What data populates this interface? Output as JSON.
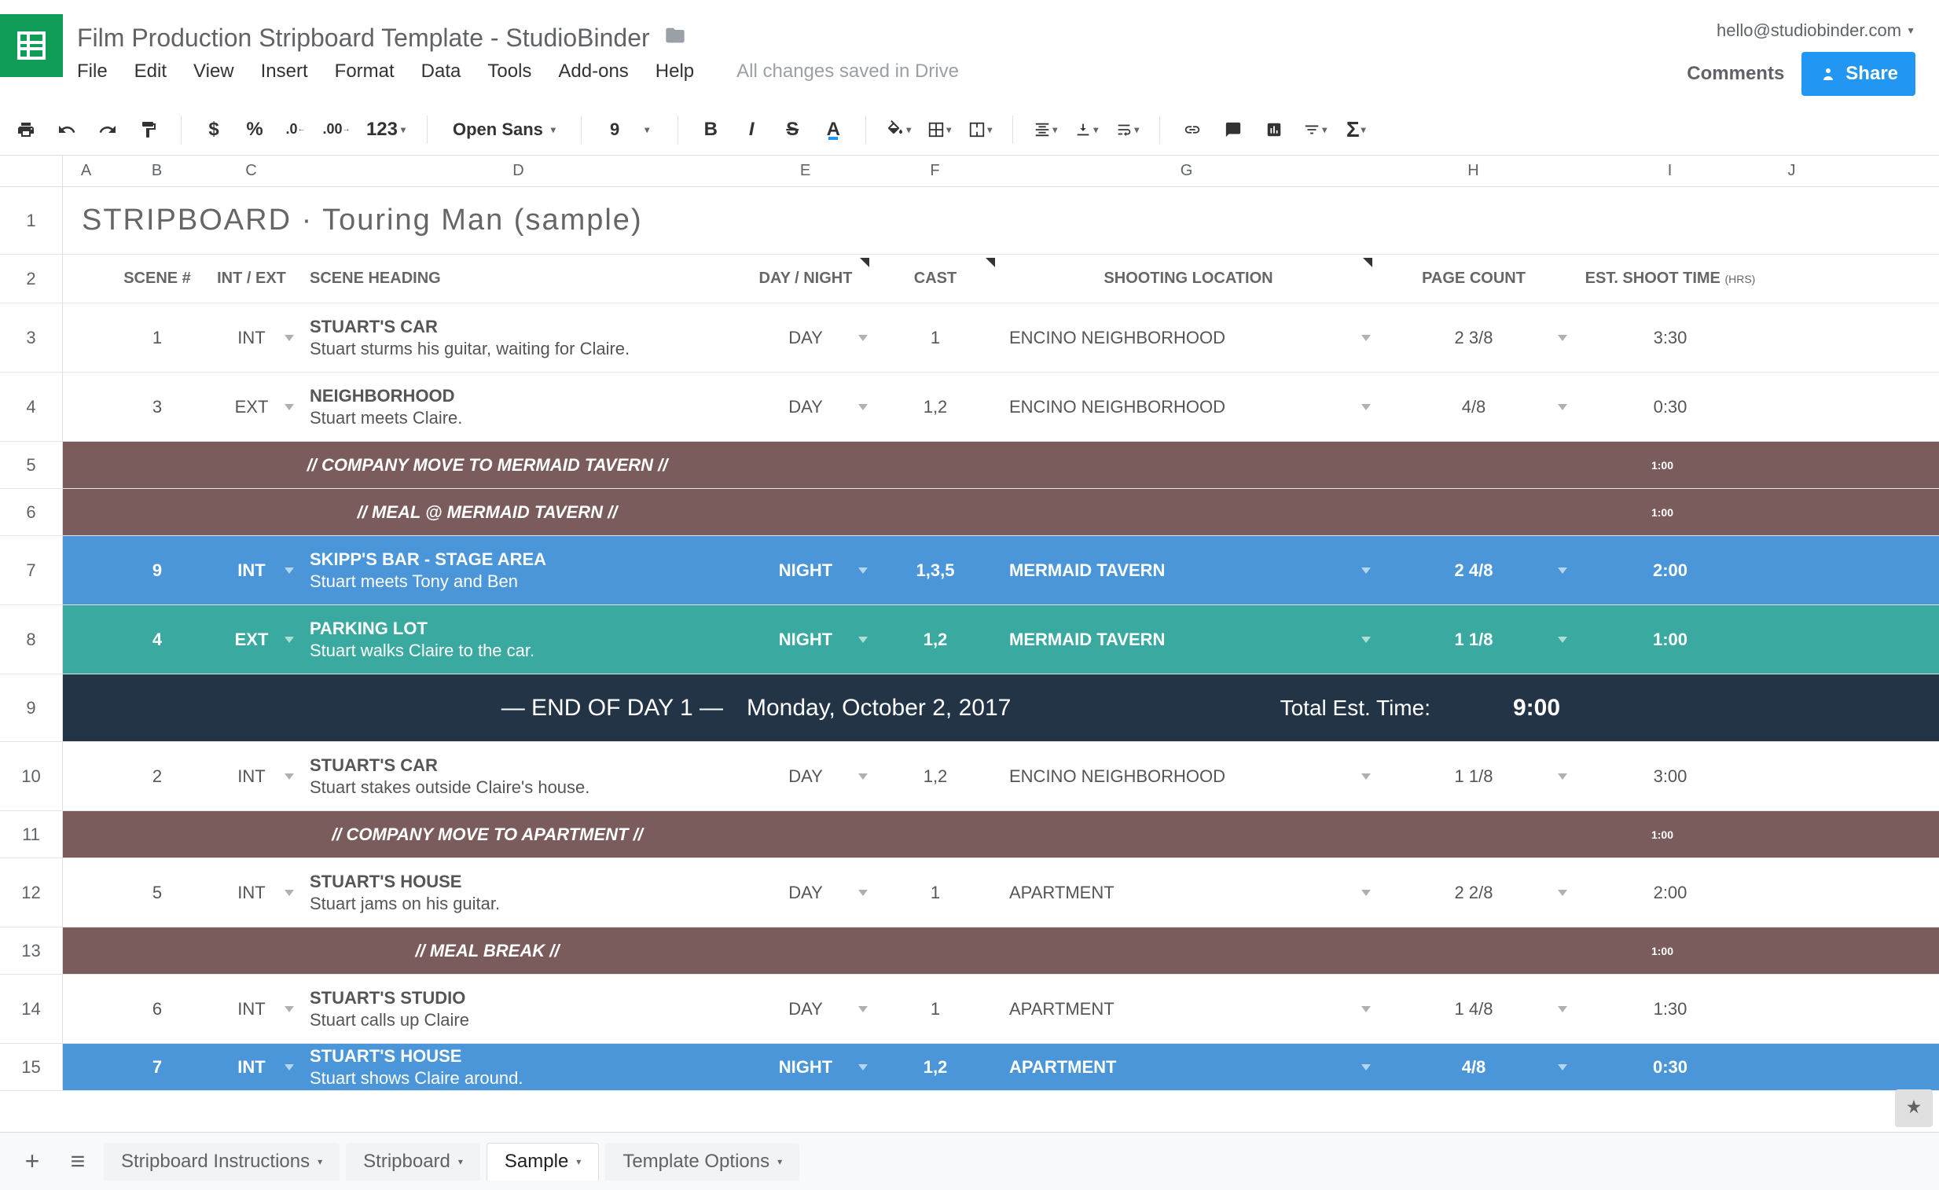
{
  "doc": {
    "title": "Film Production Stripboard Template  -  StudioBinder",
    "user_email": "hello@studiobinder.com",
    "save_status": "All changes saved in Drive",
    "comments": "Comments",
    "share": "Share"
  },
  "menu": [
    "File",
    "Edit",
    "View",
    "Insert",
    "Format",
    "Data",
    "Tools",
    "Add-ons",
    "Help"
  ],
  "toolbar": {
    "font": "Open Sans",
    "size": "9",
    "currency": "$",
    "percent": "%",
    "dec_dec": ".0",
    "dec_inc": ".00",
    "num_fmt": "123",
    "bold": "B",
    "italic": "I",
    "strike": "S",
    "text_color": "A"
  },
  "columns": [
    "A",
    "B",
    "C",
    "D",
    "E",
    "F",
    "G",
    "H",
    "I",
    "J"
  ],
  "sheet_title": "STRIPBOARD · Touring Man (sample)",
  "headers": {
    "scene": "SCENE #",
    "intext": "INT / EXT",
    "heading": "SCENE HEADING",
    "daynight": "DAY / NIGHT",
    "cast": "CAST",
    "location": "SHOOTING LOCATION",
    "pagecount": "PAGE COUNT",
    "shoottime": "EST. SHOOT TIME",
    "hrs": "(HRS)"
  },
  "rows": [
    {
      "num": "3",
      "type": "scene",
      "style": "white",
      "scene": "1",
      "intext": "INT",
      "head": "STUART'S CAR",
      "desc": "Stuart sturms his guitar, waiting for Claire.",
      "dn": "DAY",
      "cast": "1",
      "loc": "ENCINO NEIGHBORHOOD",
      "pc": "2 3/8",
      "time": "3:30"
    },
    {
      "num": "4",
      "type": "scene",
      "style": "white",
      "scene": "3",
      "intext": "EXT",
      "head": "NEIGHBORHOOD",
      "desc": "Stuart meets Claire.",
      "dn": "DAY",
      "cast": "1,2",
      "loc": "ENCINO NEIGHBORHOOD",
      "pc": "4/8",
      "time": "0:30"
    },
    {
      "num": "5",
      "type": "banner",
      "style": "brown",
      "text": "// COMPANY MOVE TO MERMAID TAVERN //",
      "time": "1:00"
    },
    {
      "num": "6",
      "type": "banner",
      "style": "brown",
      "text": "// MEAL @ MERMAID TAVERN //",
      "time": "1:00"
    },
    {
      "num": "7",
      "type": "scene",
      "style": "blue",
      "scene": "9",
      "intext": "INT",
      "head": "SKIPP'S BAR - STAGE AREA",
      "desc": "Stuart meets Tony and Ben",
      "dn": "NIGHT",
      "cast": "1,3,5",
      "loc": "MERMAID TAVERN",
      "pc": "2 4/8",
      "time": "2:00"
    },
    {
      "num": "8",
      "type": "scene",
      "style": "teal",
      "scene": "4",
      "intext": "EXT",
      "head": "PARKING LOT",
      "desc": "Stuart walks Claire to the car.",
      "dn": "NIGHT",
      "cast": "1,2",
      "loc": "MERMAID TAVERN",
      "pc": "1 1/8",
      "time": "1:00"
    },
    {
      "num": "9",
      "type": "eod",
      "style": "dark",
      "left": "— END OF DAY 1 —",
      "date": "Monday, October 2, 2017",
      "total_lbl": "Total Est. Time:",
      "total": "9:00"
    },
    {
      "num": "10",
      "type": "scene",
      "style": "white",
      "scene": "2",
      "intext": "INT",
      "head": "STUART'S CAR",
      "desc": "Stuart stakes outside Claire's house.",
      "dn": "DAY",
      "cast": "1,2",
      "loc": "ENCINO NEIGHBORHOOD",
      "pc": "1 1/8",
      "time": "3:00"
    },
    {
      "num": "11",
      "type": "banner",
      "style": "brown",
      "text": "// COMPANY MOVE TO APARTMENT //",
      "time": "1:00"
    },
    {
      "num": "12",
      "type": "scene",
      "style": "white",
      "scene": "5",
      "intext": "INT",
      "head": "STUART'S HOUSE",
      "desc": "Stuart jams on his guitar.",
      "dn": "DAY",
      "cast": "1",
      "loc": "APARTMENT",
      "pc": "2 2/8",
      "time": "2:00"
    },
    {
      "num": "13",
      "type": "banner",
      "style": "brown",
      "text": "// MEAL BREAK //",
      "time": "1:00"
    },
    {
      "num": "14",
      "type": "scene",
      "style": "white",
      "scene": "6",
      "intext": "INT",
      "head": "STUART'S STUDIO",
      "desc": "Stuart calls up Claire",
      "dn": "DAY",
      "cast": "1",
      "loc": "APARTMENT",
      "pc": "1 4/8",
      "time": "1:30"
    },
    {
      "num": "15",
      "type": "scene",
      "style": "blue",
      "scene": "7",
      "intext": "INT",
      "head": "STUART'S HOUSE",
      "desc": "Stuart shows Claire around.",
      "dn": "NIGHT",
      "cast": "1,2",
      "loc": "APARTMENT",
      "pc": "4/8",
      "time": "0:30"
    }
  ],
  "tabs": [
    "Stripboard Instructions",
    "Stripboard",
    "Sample",
    "Template Options"
  ],
  "active_tab_index": 2
}
